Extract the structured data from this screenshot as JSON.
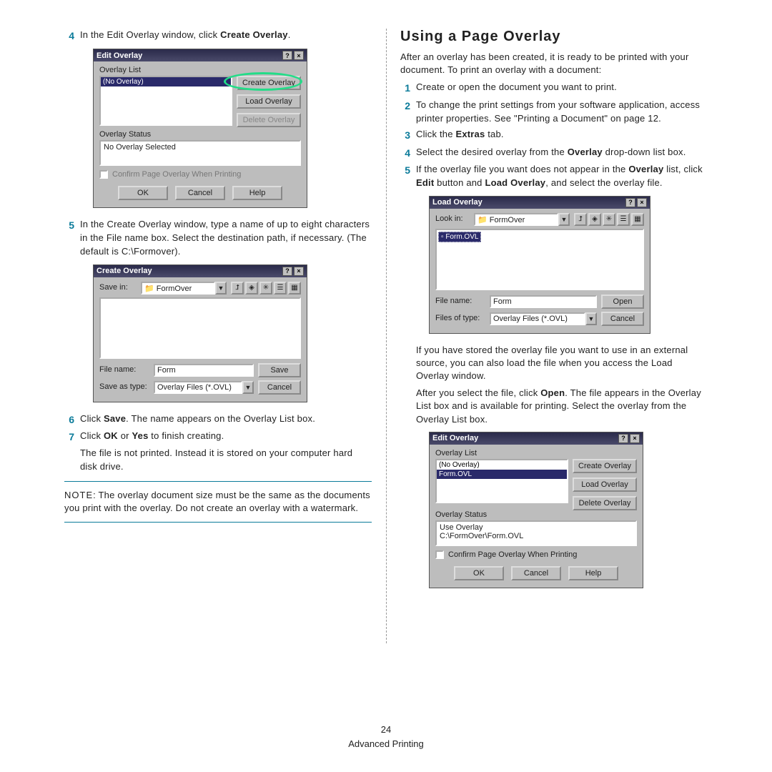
{
  "footer": {
    "page": "24",
    "section": "Advanced Printing"
  },
  "left": {
    "step4": {
      "pre": "In the Edit Overlay window, click ",
      "bold": "Create Overlay",
      "post": "."
    },
    "edit_overlay": {
      "title": "Edit Overlay",
      "overlay_list_label": "Overlay List",
      "items": [
        "(No Overlay)"
      ],
      "create": "Create Overlay",
      "load": "Load Overlay",
      "delete": "Delete Overlay",
      "status_label": "Overlay Status",
      "status_text": "No Overlay Selected",
      "confirm": "Confirm Page Overlay When Printing",
      "ok": "OK",
      "cancel": "Cancel",
      "help": "Help"
    },
    "step5": "In the Create Overlay window, type a name of up to eight characters in the File name box. Select the destination path, if necessary. (The default is C:\\Formover).",
    "create_overlay": {
      "title": "Create Overlay",
      "savein_label": "Save in:",
      "savein_value": "FormOver",
      "filename_label": "File name:",
      "filename_value": "Form",
      "saveas_label": "Save as type:",
      "saveas_value": "Overlay Files (*.OVL)",
      "save": "Save",
      "cancel": "Cancel"
    },
    "step6": {
      "pre": "Click ",
      "bold": "Save",
      "post": ". The name appears on the Overlay List box."
    },
    "step7": {
      "pre": "Click ",
      "b1": "OK",
      "mid": " or ",
      "b2": "Yes",
      "post": " to finish creating."
    },
    "step7b": "The file is not printed. Instead it is stored on your computer hard disk drive.",
    "note": {
      "label": "NOTE",
      "text": ": The overlay document size must be the same as the documents you print with the overlay. Do not create an overlay with a watermark."
    }
  },
  "right": {
    "heading": "Using a Page Overlay",
    "intro": "After an overlay has been created, it is ready to be printed with your document. To print an overlay with a document:",
    "s1": "Create or open the document you want to print.",
    "s2": "To change the print settings from your software application, access printer properties. See \"Printing a Document\" on page 12.",
    "s3": {
      "pre": "Click the ",
      "bold": "Extras",
      "post": " tab."
    },
    "s4": {
      "pre": "Select the desired overlay from the ",
      "bold": "Overlay",
      "post": " drop-down list box."
    },
    "s5": {
      "pre": "If the overlay file you want does not appear in the ",
      "b1": "Overlay",
      "mid1": " list, click ",
      "b2": "Edit",
      "mid2": " button and ",
      "b3": "Load Overlay",
      "post": ", and select the overlay file."
    },
    "load_overlay": {
      "title": "Load Overlay",
      "lookin_label": "Look in:",
      "lookin_value": "FormOver",
      "file_item": "Form.OVL",
      "filename_label": "File name:",
      "filename_value": "Form",
      "filesof_label": "Files of type:",
      "filesof_value": "Overlay Files (*.OVL)",
      "open": "Open",
      "cancel": "Cancel"
    },
    "mid1": "If you have stored the overlay file you want to use in an external source, you can also load the file when you access the Load Overlay window.",
    "mid2": {
      "pre": "After you select the file, click ",
      "bold": "Open",
      "post": ". The file appears in the Overlay List box and is available for printing. Select the overlay from the Overlay List box."
    },
    "edit_overlay2": {
      "title": "Edit Overlay",
      "overlay_list_label": "Overlay List",
      "items": [
        "(No Overlay)",
        "Form.OVL"
      ],
      "create": "Create Overlay",
      "load": "Load Overlay",
      "delete": "Delete Overlay",
      "status_label": "Overlay Status",
      "status_text1": "Use Overlay",
      "status_text2": "C:\\FormOver\\Form.OVL",
      "confirm": "Confirm Page Overlay When Printing",
      "ok": "OK",
      "cancel": "Cancel",
      "help": "Help"
    }
  }
}
